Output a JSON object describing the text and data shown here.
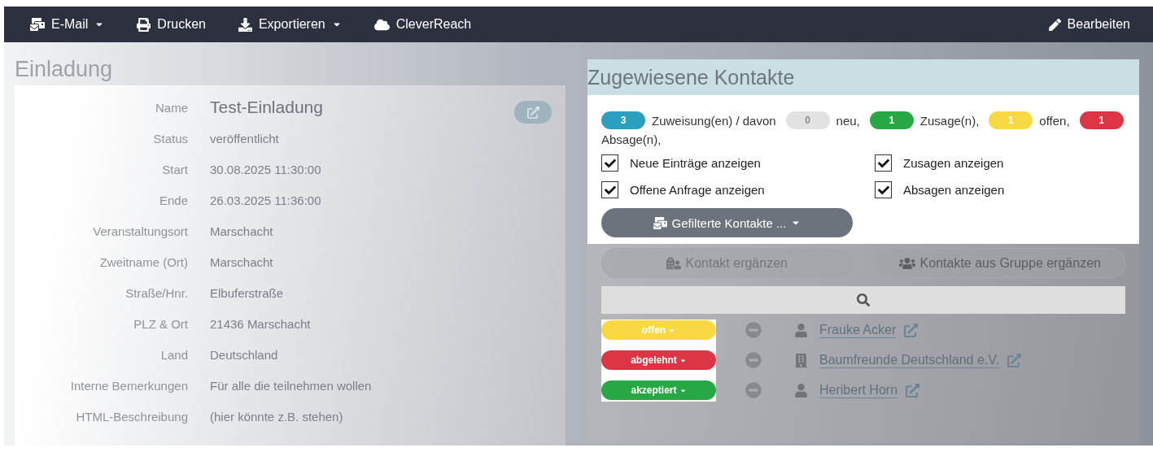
{
  "navbar": {
    "left": [
      {
        "label": "E-Mail",
        "kind": "mail",
        "dropdown": true
      },
      {
        "label": "Drucken",
        "kind": "print",
        "dropdown": false
      },
      {
        "label": "Exportieren",
        "kind": "download",
        "dropdown": true
      },
      {
        "label": "CleverReach",
        "kind": "cloud",
        "dropdown": false
      }
    ],
    "right": {
      "label": "Bearbeiten",
      "kind": "edit",
      "dropdown": false
    }
  },
  "event": {
    "title": "Einladung",
    "fields": [
      {
        "label": "Name",
        "value": "Test-Einladung",
        "kind": "title"
      },
      {
        "label": "Status",
        "value": "veröffentlicht",
        "kind": "text"
      },
      {
        "label": "Start",
        "value": "30.08.2025 11:30:00",
        "kind": "text"
      },
      {
        "label": "Ende",
        "value": "26.03.2025 11:36:00",
        "kind": "text"
      },
      {
        "label": "Veranstaltungsort",
        "value": "Marschacht",
        "kind": "text"
      },
      {
        "label": "Zweitname (Ort)",
        "value": "Marschacht",
        "kind": "text"
      },
      {
        "label": "Straße/Hnr.",
        "value": "Elbuferstraße",
        "kind": "text"
      },
      {
        "label": "PLZ & Ort",
        "value": "21436 Marschacht",
        "kind": "text"
      },
      {
        "label": "Land",
        "value": "Deutschland",
        "kind": "text"
      },
      {
        "label": "Interne Bemerkungen",
        "value": "Für alle die teilnehmen wollen",
        "kind": "text"
      },
      {
        "label": "HTML-Beschreibung",
        "value": "(hier könnte z.B. stehen)",
        "kind": "text"
      }
    ]
  },
  "contacts": {
    "title": "Zugewiesene Kontakte",
    "summary": [
      {
        "count": "3",
        "color": "#2a9fc0",
        "text": "Zuweisung(en) / davon"
      },
      {
        "count": "0",
        "color": "#e2e2e2",
        "text": "neu,"
      },
      {
        "count": "1",
        "color": "#28a745",
        "text": "Zusage(n),"
      },
      {
        "count": "1",
        "color": "#f8d944",
        "text": "offen,"
      },
      {
        "count": "1",
        "color": "#dc3545",
        "text": "Absage(n),"
      }
    ],
    "filters": [
      {
        "label": "Neue Einträge anzeigen",
        "checked": true
      },
      {
        "label": "Zusagen anzeigen",
        "checked": true
      },
      {
        "label": "Offene Anfrage anzeigen",
        "checked": true
      },
      {
        "label": "Absagen anzeigen",
        "checked": true
      }
    ],
    "filter_button": "Gefilterte Kontakte ...",
    "add_buttons": [
      {
        "label": "Kontakt ergänzen",
        "kind": "building"
      },
      {
        "label": "Kontakte aus Gruppe ergänzen",
        "kind": "group"
      }
    ],
    "rows": [
      {
        "status": "offen",
        "color": "#f8d944",
        "kind": "person",
        "name": "Frauke Acker"
      },
      {
        "status": "abgelehnt",
        "color": "#dc3545",
        "kind": "organization",
        "name": "Baumfreunde Deutschland e.V."
      },
      {
        "status": "akzeptiert",
        "color": "#28a745",
        "kind": "person",
        "name": "Heribert Horn"
      }
    ]
  }
}
